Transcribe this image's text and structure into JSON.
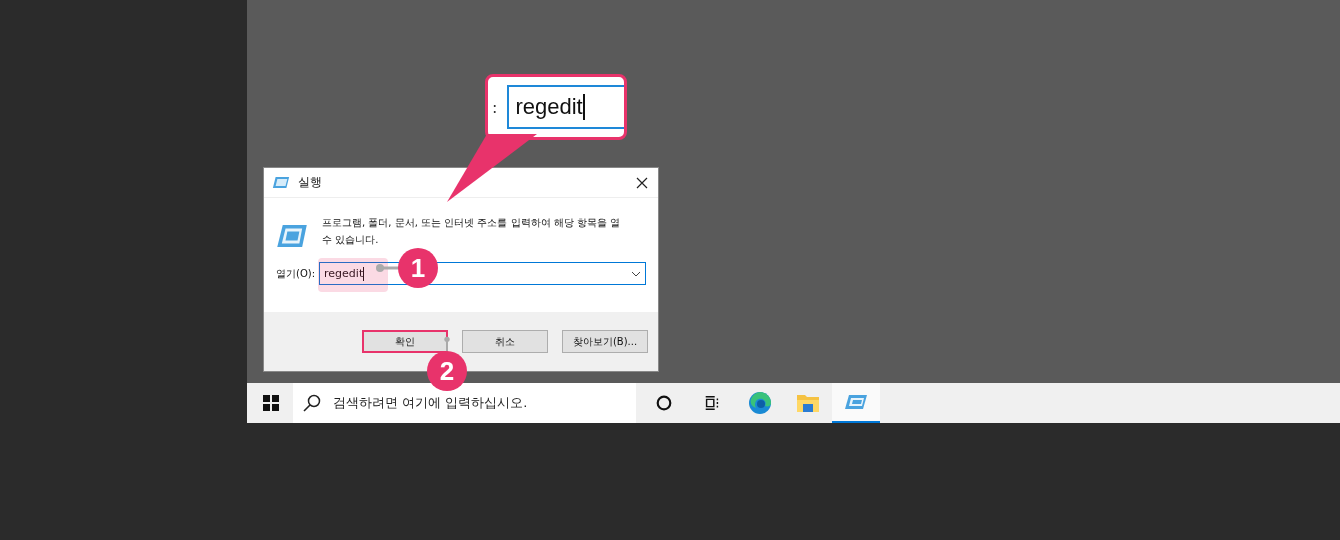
{
  "dialog": {
    "title": "실행",
    "description": "프로그램, 폴더, 문서, 또는 인터넷 주소를 입력하여 해당 항목을 열 수 있습니다.",
    "open_label": "열기(O):",
    "open_value": "regedit",
    "buttons": [
      {
        "label": "확인",
        "highlighted": true
      },
      {
        "label": "취소",
        "highlighted": false
      },
      {
        "label": "찾아보기(B)...",
        "highlighted": false
      }
    ]
  },
  "callout": {
    "label": ":",
    "value": "regedit"
  },
  "markers": [
    "1",
    "2"
  ],
  "taskbar": {
    "search_placeholder": "검색하려면 여기에 입력하십시오.",
    "apps": [
      {
        "kind": "cortana",
        "active": false
      },
      {
        "kind": "taskview",
        "active": false
      },
      {
        "kind": "edge",
        "active": false
      },
      {
        "kind": "explorer",
        "active": false
      },
      {
        "kind": "run",
        "active": true
      }
    ]
  }
}
